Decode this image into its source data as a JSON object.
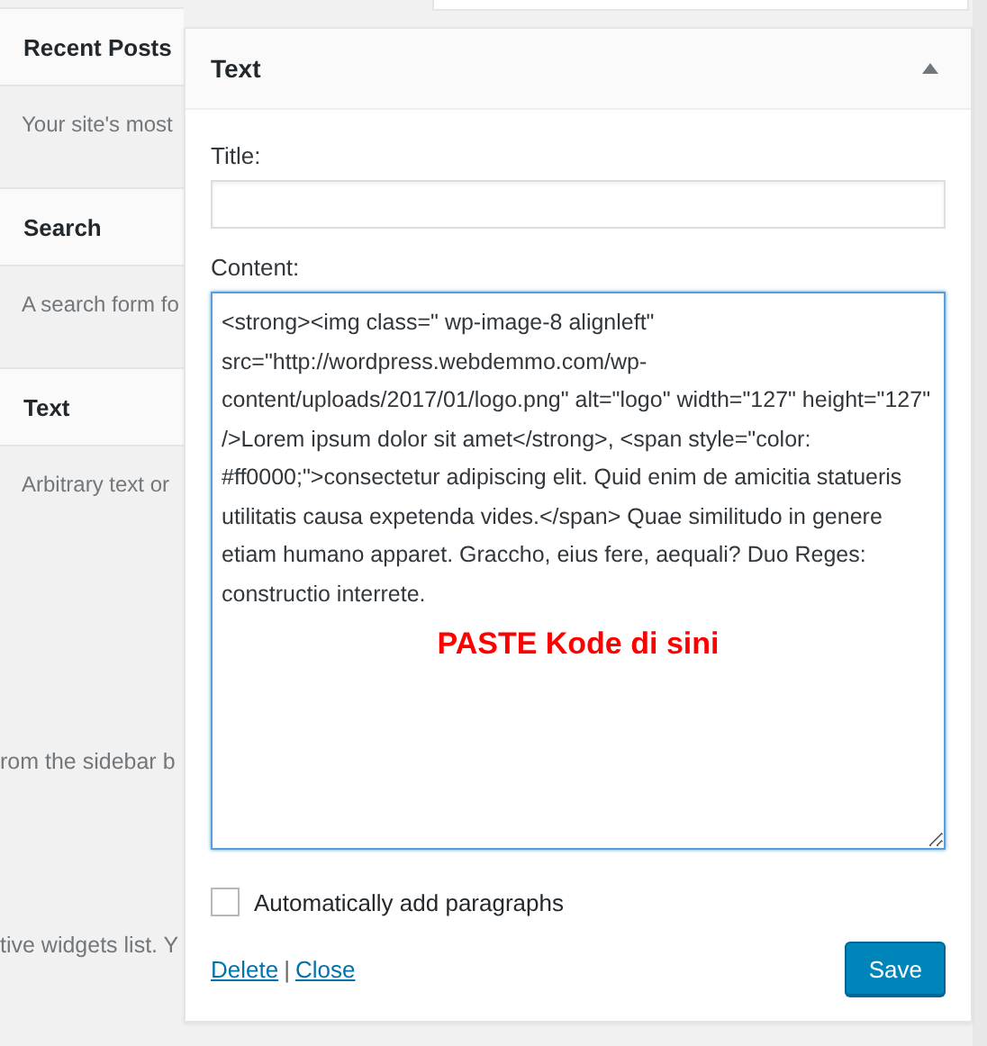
{
  "available_widgets": [
    {
      "title": "Recent Posts",
      "description": "Your site's most"
    },
    {
      "title": "Search",
      "description": "A search form fo"
    },
    {
      "title": "Text",
      "description": "Arbitrary text or"
    }
  ],
  "help_lines": [
    "rom the sidebar b",
    "tive widgets list. Y"
  ],
  "widget_panel": {
    "title": "Text",
    "expanded": true,
    "title_field": {
      "label": "Title:"
    },
    "content_field": {
      "label": "Content:",
      "value": "<strong><img class=\" wp-image-8 alignleft\" src=\"http://wordpress.webdemmo.com/wp-content/uploads/2017/01/logo.png\" alt=\"logo\" width=\"127\" height=\"127\" />Lorem ipsum dolor sit amet</strong>, <span style=\"color: #ff0000;\">consectetur adipiscing elit. Quid enim de amicitia statueris utilitatis causa expetenda vides.</span> Quae similitudo in genere etiam humano apparet. Graccho, eius fere, aequali? Duo Reges: constructio interrete."
    },
    "overlay_note": "PASTE Kode di sini",
    "auto_paragraphs": {
      "label": "Automatically add paragraphs",
      "checked": false
    },
    "links": [
      "Delete",
      "Close"
    ],
    "separator": "|",
    "save_button": "Save"
  }
}
